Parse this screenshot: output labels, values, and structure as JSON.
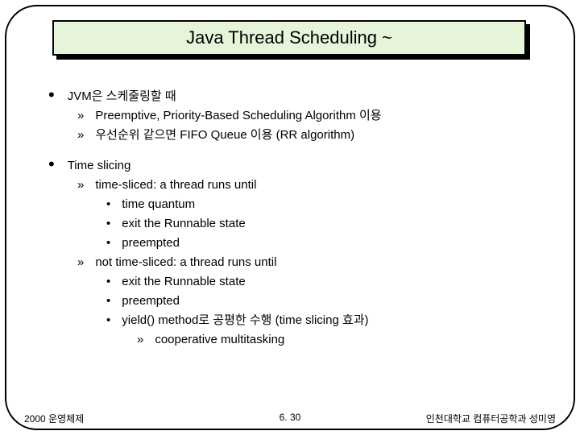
{
  "title": "Java Thread Scheduling ~",
  "b1": {
    "head": "JVM은 스케줄링할 때",
    "s1": "Preemptive, Priority-Based Scheduling Algorithm 이용",
    "s2": "우선순위 같으면 FIFO Queue 이용 (RR algorithm)"
  },
  "b2": {
    "head": "Time slicing",
    "ts": {
      "head": "time-sliced: a thread runs until",
      "i1": "time quantum",
      "i2": "exit the Runnable state",
      "i3": "preempted"
    },
    "nts": {
      "head": "not time-sliced: a thread runs until",
      "i1": "exit the Runnable state",
      "i2": "preempted",
      "i3": "yield() method로 공평한 수행 (time slicing 효과)",
      "sub": "cooperative multitasking"
    }
  },
  "footer": {
    "left": "2000 운영체제",
    "center": "6. 30",
    "right": "인천대학교 컴퓨터공학과 성미영"
  }
}
